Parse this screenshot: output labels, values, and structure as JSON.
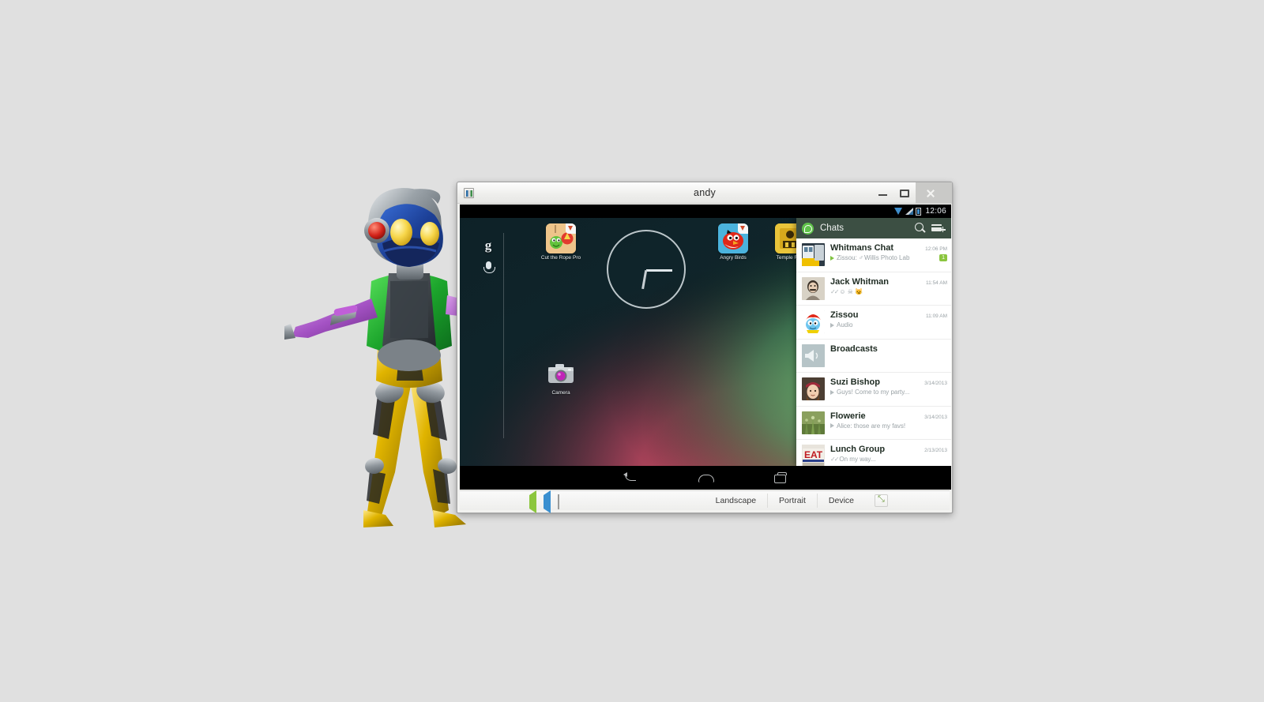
{
  "window": {
    "title": "andy",
    "app_icon": "app-window-icon",
    "controls": {
      "minimize": "minimize-button",
      "maximize": "maximize-button",
      "close": "close-button"
    }
  },
  "android": {
    "statusbar": {
      "time": "12:06",
      "icons": [
        "wifi-icon",
        "signal-icon",
        "battery-icon"
      ]
    },
    "search_widget": {
      "logo": "google-g-logo",
      "mic": "microphone-icon"
    },
    "clock_widget": {
      "name": "analog-clock-widget"
    },
    "apps": [
      {
        "label": "Cut the Rope Pro",
        "icon": "cut-the-rope-icon"
      },
      {
        "label": "Angry Birds",
        "icon": "angry-birds-icon"
      },
      {
        "label": "Temple Run",
        "icon": "temple-run-icon"
      },
      {
        "label": "Camera",
        "icon": "camera-icon"
      }
    ],
    "navbar": {
      "back": "back-button",
      "home": "home-button",
      "recents": "recent-apps-button"
    }
  },
  "whatsapp": {
    "header": {
      "title": "Chats",
      "logo": "whatsapp-logo",
      "search": "search-icon",
      "new_chat": "new-chat-icon"
    },
    "chats": [
      {
        "name": "Whitmans Chat",
        "time": "12:06 PM",
        "message": "Zissou: Willis Photo Lab",
        "sender": "Zissou:",
        "body": "Willis Photo Lab",
        "unread": "1",
        "has_location_pin": true,
        "play_icon": "green",
        "avatar": "train-photo-avatar"
      },
      {
        "name": "Jack Whitman",
        "time": "11:54 AM",
        "message": "☺ ☠ 😼",
        "ticks": "✓✓",
        "avatar": "jack-whitman-avatar"
      },
      {
        "name": "Zissou",
        "time": "11:09 AM",
        "message": "Audio",
        "play_icon": "gray",
        "avatar": "zissou-smurf-avatar"
      },
      {
        "name": "Broadcasts",
        "time": "",
        "message": "",
        "avatar": "broadcast-megaphone-avatar"
      },
      {
        "name": "Suzi Bishop",
        "time": "3/14/2013",
        "message": "Guys! Come to my party...",
        "play_icon": "gray",
        "avatar": "suzi-bishop-avatar"
      },
      {
        "name": "Flowerie",
        "time": "3/14/2013",
        "message": "Alice: those are my favs!",
        "play_icon": "gray",
        "avatar": "flowers-avatar"
      },
      {
        "name": "Lunch Group",
        "time": "2/13/2013",
        "message": "On my way...",
        "ticks": "✓✓",
        "avatar": "eat-sign-avatar"
      }
    ]
  },
  "toolbar": {
    "left_icons": [
      "rotate-left-icon",
      "rotate-right-icon",
      "screenshot-icon"
    ],
    "landscape_label": "Landscape",
    "portrait_label": "Portrait",
    "device_label": "Device",
    "fullscreen_icon": "fullscreen-icon"
  },
  "mascot": {
    "name": "andy-robot-mascot"
  },
  "colors": {
    "accent_green": "#8bc53f",
    "wa_header": "#3c4f43",
    "desktop_bg": "#e0e0e0"
  }
}
